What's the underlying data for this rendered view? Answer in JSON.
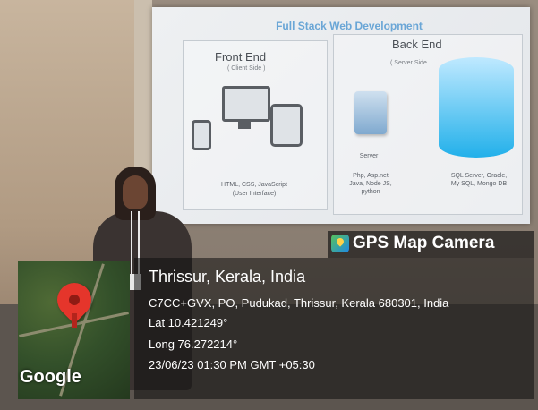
{
  "slide": {
    "title": "Full Stack Web Development",
    "front_end": {
      "heading": "Front End",
      "subheading": "( Client Side )",
      "technologies": "HTML, CSS, JavaScript",
      "caption": "(User Interface)"
    },
    "back_end": {
      "heading": "Back End",
      "subheading": "( Server Side",
      "server_label": "Server",
      "server_tech_1": "Php, Asp.net",
      "server_tech_2": "Java, Node JS,",
      "server_tech_3": "python",
      "db_tech_1": "SQL Server, Oracle,",
      "db_tech_2": "My SQL, Mongo DB"
    }
  },
  "stamp": {
    "app_name": "GPS Map Camera",
    "place": "Thrissur, Kerala, India",
    "address": "C7CC+GVX, PO, Pudukad, Thrissur, Kerala 680301, India",
    "latitude": "Lat 10.421249°",
    "longitude": "Long 76.272214°",
    "datetime": "23/06/23 01:30 PM GMT +05:30",
    "map_logo": "Google",
    "icon": "map-camera-icon"
  },
  "colors": {
    "pin": "#e5352b",
    "slide_title": "#6aa6d6",
    "database": "#22b0ea"
  }
}
